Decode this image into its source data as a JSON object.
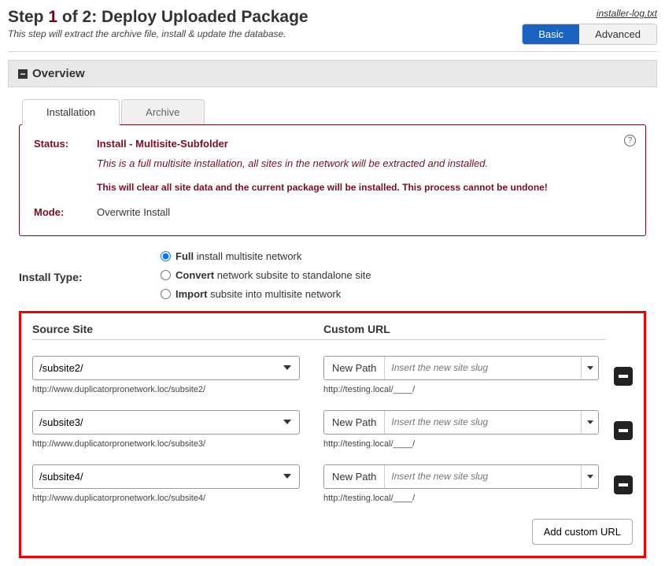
{
  "header": {
    "step_label_prefix": "Step ",
    "step_num": "1",
    "step_label_mid": " of 2: ",
    "title": "Deploy Uploaded Package",
    "subtitle": "This step will extract the archive file, install & update the database.",
    "log_link": "installer-log.txt",
    "mode_basic": "Basic",
    "mode_advanced": "Advanced"
  },
  "overview": {
    "label": "Overview"
  },
  "tabs": {
    "installation": "Installation",
    "archive": "Archive"
  },
  "status": {
    "status_label": "Status:",
    "status_title": "Install - Multisite-Subfolder",
    "status_desc": "This is a full multisite installation, all sites in the network will be extracted and installed.",
    "status_warn": "This will clear all site data and the current package will be installed. This process cannot be undone!",
    "mode_label": "Mode:",
    "mode_value": "Overwrite Install"
  },
  "install_type": {
    "label": "Install Type:",
    "options": [
      {
        "bold": "Full",
        "rest": " install multisite network",
        "checked": true
      },
      {
        "bold": "Convert",
        "rest": " network subsite to standalone site",
        "checked": false
      },
      {
        "bold": "Import",
        "rest": " subsite into multisite network",
        "checked": false
      }
    ]
  },
  "columns": {
    "source": "Source Site",
    "custom": "Custom URL"
  },
  "rows": [
    {
      "site": "/subsite2/",
      "site_url": "http://www.duplicatorpronetwork.loc/subsite2/",
      "new_path_label": "New Path",
      "placeholder": "Insert the new site slug",
      "target_hint": "http://testing.local/____/"
    },
    {
      "site": "/subsite3/",
      "site_url": "http://www.duplicatorpronetwork.loc/subsite3/",
      "new_path_label": "New Path",
      "placeholder": "Insert the new site slug",
      "target_hint": "http://testing.local/____/"
    },
    {
      "site": "/subsite4/",
      "site_url": "http://www.duplicatorpronetwork.loc/subsite4/",
      "new_path_label": "New Path",
      "placeholder": "Insert the new site slug",
      "target_hint": "http://testing.local/____/"
    }
  ],
  "add_button": "Add custom URL"
}
